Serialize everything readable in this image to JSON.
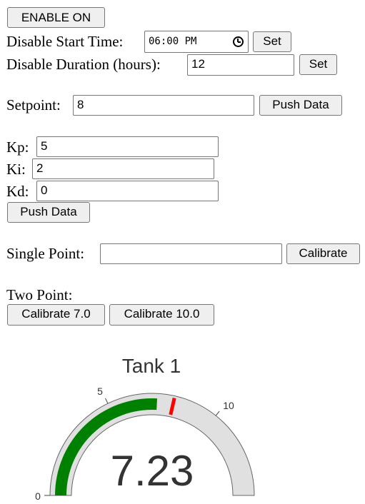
{
  "controls": {
    "enable_button": "ENABLE ON",
    "disable_start": {
      "label": "Disable Start Time:",
      "value": "06:00 PM",
      "set_button": "Set"
    },
    "disable_duration": {
      "label": "Disable Duration (hours):",
      "value": "12",
      "set_button": "Set"
    }
  },
  "setpoint": {
    "label": "Setpoint:",
    "value": "8",
    "push_button": "Push Data"
  },
  "pid": {
    "kp_label": "Kp:",
    "kp_value": "5",
    "ki_label": "Ki:",
    "ki_value": "2",
    "kd_label": "Kd:",
    "kd_value": "0",
    "push_button": "Push Data"
  },
  "calibration": {
    "single_label": "Single Point:",
    "single_value": "",
    "single_button": "Calibrate",
    "two_label": "Two Point:",
    "btn_7": "Calibrate 7.0",
    "btn_10": "Calibrate 10.0"
  },
  "gauge": {
    "title": "Tank 1",
    "value": 7.23,
    "value_text": "7.23",
    "min": 0,
    "max": 14,
    "threshold": 8,
    "tick_labels": [
      "0",
      "5",
      "10"
    ],
    "bar_color": "#008000",
    "track_color": "#e0e0e0",
    "threshold_color": "#ff0000"
  }
}
